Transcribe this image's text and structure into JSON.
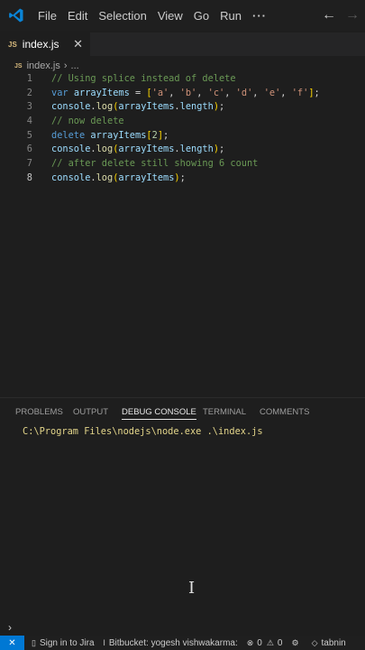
{
  "menu": {
    "items": [
      "File",
      "Edit",
      "Selection",
      "View",
      "Go",
      "Run"
    ],
    "more": "···"
  },
  "nav": {
    "back": "←",
    "forward": "→"
  },
  "tab": {
    "badge": "JS",
    "filename": "index.js",
    "close": "✕"
  },
  "breadcrumb": {
    "badge": "JS",
    "file": "index.js",
    "sep": "›",
    "more": "..."
  },
  "editor": {
    "lines": [
      {
        "n": "1",
        "tokens": [
          {
            "c": "cm",
            "t": "// Using splice instead of delete"
          }
        ]
      },
      {
        "n": "2",
        "tokens": [
          {
            "c": "kw",
            "t": "var "
          },
          {
            "c": "var",
            "t": "arrayItems"
          },
          {
            "c": "pun",
            "t": " = "
          },
          {
            "c": "br1",
            "t": "["
          },
          {
            "c": "str",
            "t": "'a'"
          },
          {
            "c": "pun",
            "t": ", "
          },
          {
            "c": "str",
            "t": "'b'"
          },
          {
            "c": "pun",
            "t": ", "
          },
          {
            "c": "str",
            "t": "'c'"
          },
          {
            "c": "pun",
            "t": ", "
          },
          {
            "c": "str",
            "t": "'d'"
          },
          {
            "c": "pun",
            "t": ", "
          },
          {
            "c": "str",
            "t": "'e'"
          },
          {
            "c": "pun",
            "t": ", "
          },
          {
            "c": "str",
            "t": "'f'"
          },
          {
            "c": "br1",
            "t": "]"
          },
          {
            "c": "pun",
            "t": ";"
          }
        ]
      },
      {
        "n": "3",
        "tokens": [
          {
            "c": "var",
            "t": "console"
          },
          {
            "c": "pun",
            "t": "."
          },
          {
            "c": "fn",
            "t": "log"
          },
          {
            "c": "br1",
            "t": "("
          },
          {
            "c": "var",
            "t": "arrayItems"
          },
          {
            "c": "pun",
            "t": "."
          },
          {
            "c": "var",
            "t": "length"
          },
          {
            "c": "br1",
            "t": ")"
          },
          {
            "c": "pun",
            "t": ";"
          }
        ]
      },
      {
        "n": "4",
        "tokens": [
          {
            "c": "cm",
            "t": "// now delete"
          }
        ]
      },
      {
        "n": "5",
        "tokens": [
          {
            "c": "kw",
            "t": "delete "
          },
          {
            "c": "var",
            "t": "arrayItems"
          },
          {
            "c": "br1",
            "t": "["
          },
          {
            "c": "num",
            "t": "2"
          },
          {
            "c": "br1",
            "t": "]"
          },
          {
            "c": "pun",
            "t": ";"
          }
        ]
      },
      {
        "n": "6",
        "tokens": [
          {
            "c": "var",
            "t": "console"
          },
          {
            "c": "pun",
            "t": "."
          },
          {
            "c": "fn",
            "t": "log"
          },
          {
            "c": "br1",
            "t": "("
          },
          {
            "c": "var",
            "t": "arrayItems"
          },
          {
            "c": "pun",
            "t": "."
          },
          {
            "c": "var",
            "t": "length"
          },
          {
            "c": "br1",
            "t": ")"
          },
          {
            "c": "pun",
            "t": ";"
          }
        ]
      },
      {
        "n": "7",
        "tokens": [
          {
            "c": "cm",
            "t": "// after delete still showing 6 count"
          }
        ]
      },
      {
        "n": "8",
        "active": true,
        "tokens": [
          {
            "c": "var",
            "t": "console"
          },
          {
            "c": "pun",
            "t": "."
          },
          {
            "c": "fn",
            "t": "log"
          },
          {
            "c": "br1",
            "t": "("
          },
          {
            "c": "var",
            "t": "arrayItems"
          },
          {
            "c": "br1",
            "t": ")"
          },
          {
            "c": "pun",
            "t": ";"
          }
        ]
      }
    ]
  },
  "panel": {
    "tabs": [
      {
        "label": "PROBLEMS",
        "active": false
      },
      {
        "label": "OUTPUT",
        "active": false
      },
      {
        "label": "DEBUG CONSOLE",
        "active": true
      },
      {
        "label": "TERMINAL",
        "active": false
      },
      {
        "label": "COMMENTS",
        "active": false
      }
    ],
    "console_line": "C:\\Program Files\\nodejs\\node.exe .\\index.js",
    "prompt": "›"
  },
  "statusbar": {
    "remote": "✕",
    "jira": "Sign in to Jira",
    "bitbucket": "Bitbucket: yogesh vishwakarma:",
    "errors": "0",
    "warnings": "0",
    "tabnine": "tabnin"
  },
  "colors": {
    "accent": "#0078d4",
    "background": "#1e1e1e",
    "comment": "#6a9955",
    "keyword": "#569cd6"
  }
}
